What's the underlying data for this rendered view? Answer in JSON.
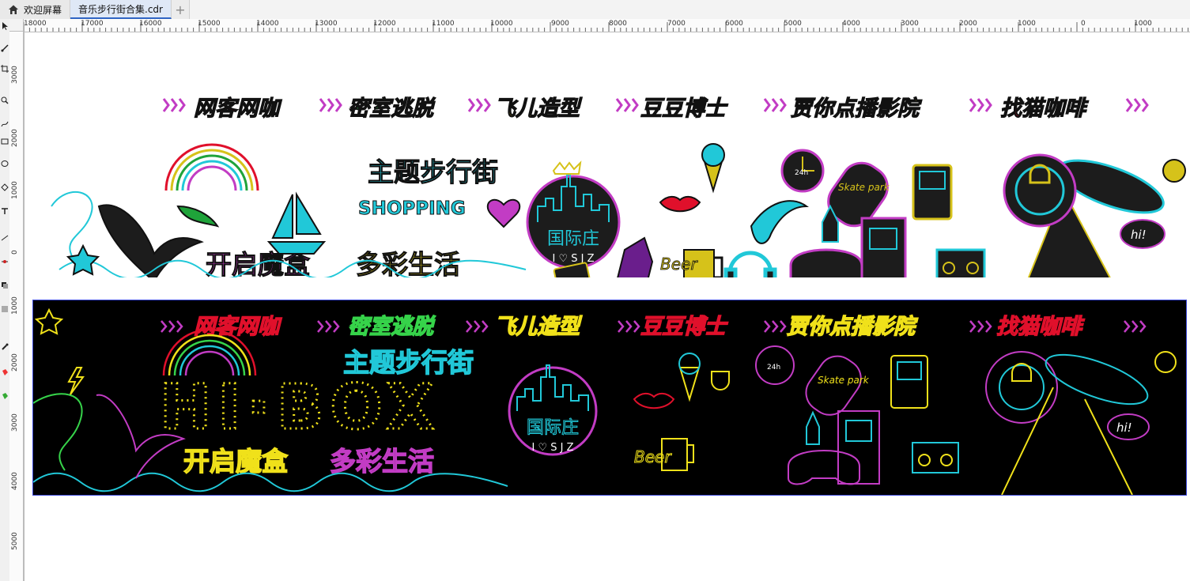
{
  "tabs": [
    {
      "label": "欢迎屏幕",
      "icon": "home-icon"
    },
    {
      "label": "音乐步行街合集.cdr",
      "icon": ""
    }
  ],
  "ruler": {
    "h_labels": [
      "18000",
      "17000",
      "16000",
      "15000",
      "14000",
      "13000",
      "12000",
      "11000",
      "10000",
      "9000",
      "8000",
      "7000",
      "6000",
      "5000",
      "4000",
      "3000",
      "2000",
      "1000",
      "0",
      "1000"
    ],
    "v_labels": [
      "3000",
      "2000",
      "1000",
      "0",
      "1000",
      "2000",
      "3000",
      "4000",
      "5000"
    ]
  },
  "banner_top": {
    "categories": [
      "网客网咖",
      "密室逃脱",
      "飞儿造型",
      "豆豆博士",
      "贾你点播影院",
      "找猫咖啡"
    ],
    "street_title": "主题步行街",
    "shopping": "SHOPPING",
    "slogan_left": "开启魔盒",
    "slogan_right": "多彩生活",
    "badge_title": "国际庄",
    "badge_sub": "I ♡ S J Z",
    "beer": "Beer",
    "hi": "hi!",
    "skate": "Skate park",
    "clock": "24h"
  },
  "banner_bottom": {
    "categories": [
      "网客网咖",
      "密室逃脱",
      "飞儿造型",
      "豆豆博士",
      "贾你点播影院",
      "找猫咖啡"
    ],
    "street_title": "主题步行街",
    "hibox": "HI·BOX",
    "slogan_left": "开启魔盒",
    "slogan_right": "多彩生活",
    "badge_title": "国际庄",
    "badge_sub": "I ♡ S J Z",
    "beer": "Beer",
    "hi": "hi!",
    "skate": "Skate park",
    "clock": "24h"
  },
  "colors": {
    "cat": [
      "#e0102b",
      "#1fa33a",
      "#d6c21a",
      "#e0102b",
      "#d6c21a",
      "#e0102b"
    ],
    "neon_cyan": "#21c8d8",
    "neon_magenta": "#c23cc4",
    "neon_yellow": "#f0e11a",
    "neon_green": "#36d34a",
    "dark_fill": "#1c1c1c"
  }
}
